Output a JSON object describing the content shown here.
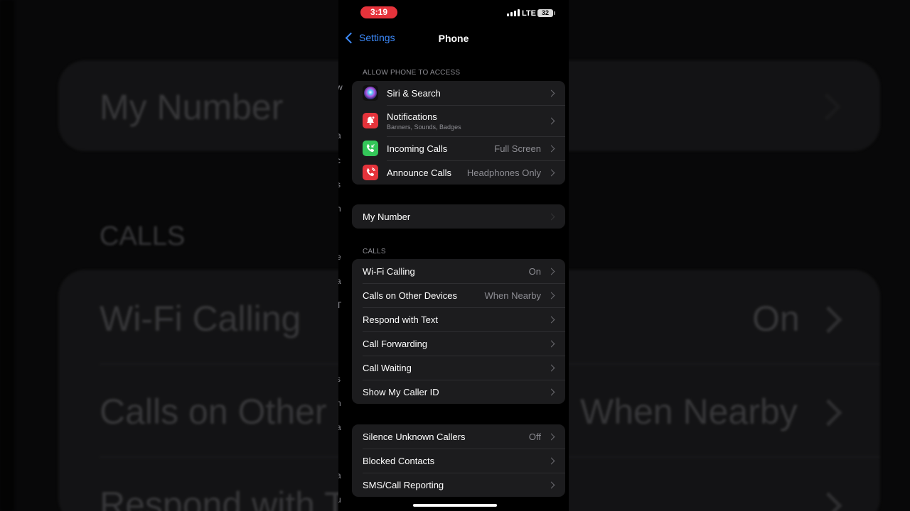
{
  "status_bar": {
    "time": "3:19",
    "network": "LTE",
    "battery": "32"
  },
  "nav": {
    "back_label": "Settings",
    "title": "Phone"
  },
  "allow_access": {
    "header": "ALLOW PHONE TO ACCESS",
    "items": [
      {
        "label": "Siri & Search",
        "sublabel": "",
        "value": ""
      },
      {
        "label": "Notifications",
        "sublabel": "Banners, Sounds, Badges",
        "value": ""
      },
      {
        "label": "Incoming Calls",
        "sublabel": "",
        "value": "Full Screen"
      },
      {
        "label": "Announce Calls",
        "sublabel": "",
        "value": "Headphones Only"
      }
    ]
  },
  "my_number": {
    "label": "My Number"
  },
  "calls": {
    "header": "CALLS",
    "items": [
      {
        "label": "Wi-Fi Calling",
        "value": "On"
      },
      {
        "label": "Calls on Other Devices",
        "value": "When Nearby"
      },
      {
        "label": "Respond with Text",
        "value": ""
      },
      {
        "label": "Call Forwarding",
        "value": ""
      },
      {
        "label": "Call Waiting",
        "value": ""
      },
      {
        "label": "Show My Caller ID",
        "value": ""
      }
    ]
  },
  "blocking": {
    "items": [
      {
        "label": "Silence Unknown Callers",
        "value": "Off"
      },
      {
        "label": "Blocked Contacts",
        "value": ""
      },
      {
        "label": "SMS/Call Reporting",
        "value": ""
      }
    ]
  },
  "background": {
    "my_number": "My Number",
    "calls_header": "CALLS",
    "wifi_calling": "Wi-Fi Calling",
    "wifi_value": "On",
    "other_devices": "Calls on Other Devices",
    "other_value": "When Nearby",
    "respond": "Respond with T"
  },
  "colors": {
    "accent": "#3d8bfd",
    "time_pill": "#e5333b",
    "siri_icon": "#1e2a6b",
    "notifications_icon": "#e5333b",
    "incoming_calls_icon": "#34c759",
    "announce_calls_icon": "#e5333b"
  },
  "icons": [
    "signal-icon",
    "battery-icon",
    "back-chevron-icon",
    "siri-icon",
    "notifications-icon",
    "incoming-calls-icon",
    "announce-calls-icon",
    "chevron-right-icon"
  ]
}
